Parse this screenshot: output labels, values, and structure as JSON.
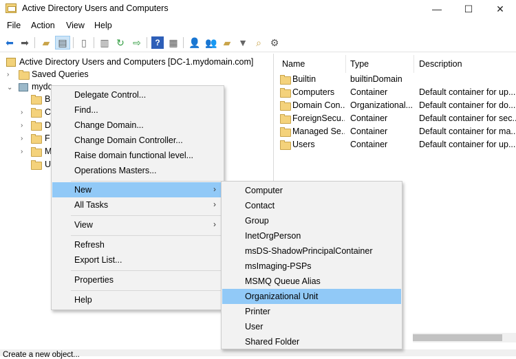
{
  "window": {
    "title": "Active Directory Users and Computers",
    "controls": {
      "minimize": "—",
      "maximize": "☐",
      "close": "✕"
    }
  },
  "menubar": {
    "items": [
      "File",
      "Action",
      "View",
      "Help"
    ]
  },
  "toolbar": {
    "buttons": [
      "back-icon",
      "forward-icon",
      "up-folder-icon",
      "show-tree-icon",
      "properties-icon",
      "list-icon",
      "refresh-icon",
      "export-icon",
      "help-icon",
      "mmc-icon",
      "new-user-icon",
      "new-group-icon",
      "new-ou-icon",
      "filter-icon",
      "find-icon",
      "delegate-icon"
    ]
  },
  "tree": {
    "root": "Active Directory Users and Computers [DC-1.mydomain.com]",
    "saved_queries": "Saved Queries",
    "domain": "mydo",
    "children": [
      "B",
      "C",
      "D",
      "F",
      "M",
      "U"
    ]
  },
  "list": {
    "columns": [
      "Name",
      "Type",
      "Description"
    ],
    "rows": [
      {
        "name": "Builtin",
        "type": "builtinDomain",
        "description": ""
      },
      {
        "name": "Computers",
        "type": "Container",
        "description": "Default container for up..."
      },
      {
        "name": "Domain Con...",
        "type": "Organizational...",
        "description": "Default container for do..."
      },
      {
        "name": "ForeignSecu...",
        "type": "Container",
        "description": "Default container for sec..."
      },
      {
        "name": "Managed Se...",
        "type": "Container",
        "description": "Default container for ma..."
      },
      {
        "name": "Users",
        "type": "Container",
        "description": "Default container for up..."
      }
    ]
  },
  "context_menu": {
    "delegate": "Delegate Control...",
    "find": "Find...",
    "change_domain": "Change Domain...",
    "change_dc": "Change Domain Controller...",
    "raise": "Raise domain functional level...",
    "ops": "Operations Masters...",
    "new": "New",
    "all_tasks": "All Tasks",
    "view": "View",
    "refresh": "Refresh",
    "export": "Export List...",
    "properties": "Properties",
    "help": "Help",
    "arrow": "›"
  },
  "new_submenu": {
    "items": [
      "Computer",
      "Contact",
      "Group",
      "InetOrgPerson",
      "msDS-ShadowPrincipalContainer",
      "msImaging-PSPs",
      "MSMQ Queue Alias",
      "Organizational Unit",
      "Printer",
      "User",
      "Shared Folder"
    ],
    "highlighted": "Organizational Unit"
  },
  "status": {
    "text": "Create a new object..."
  },
  "colors": {
    "highlight": "#91c9f7",
    "menu_bg": "#f2f2f2",
    "folder": "#f4d27b"
  }
}
